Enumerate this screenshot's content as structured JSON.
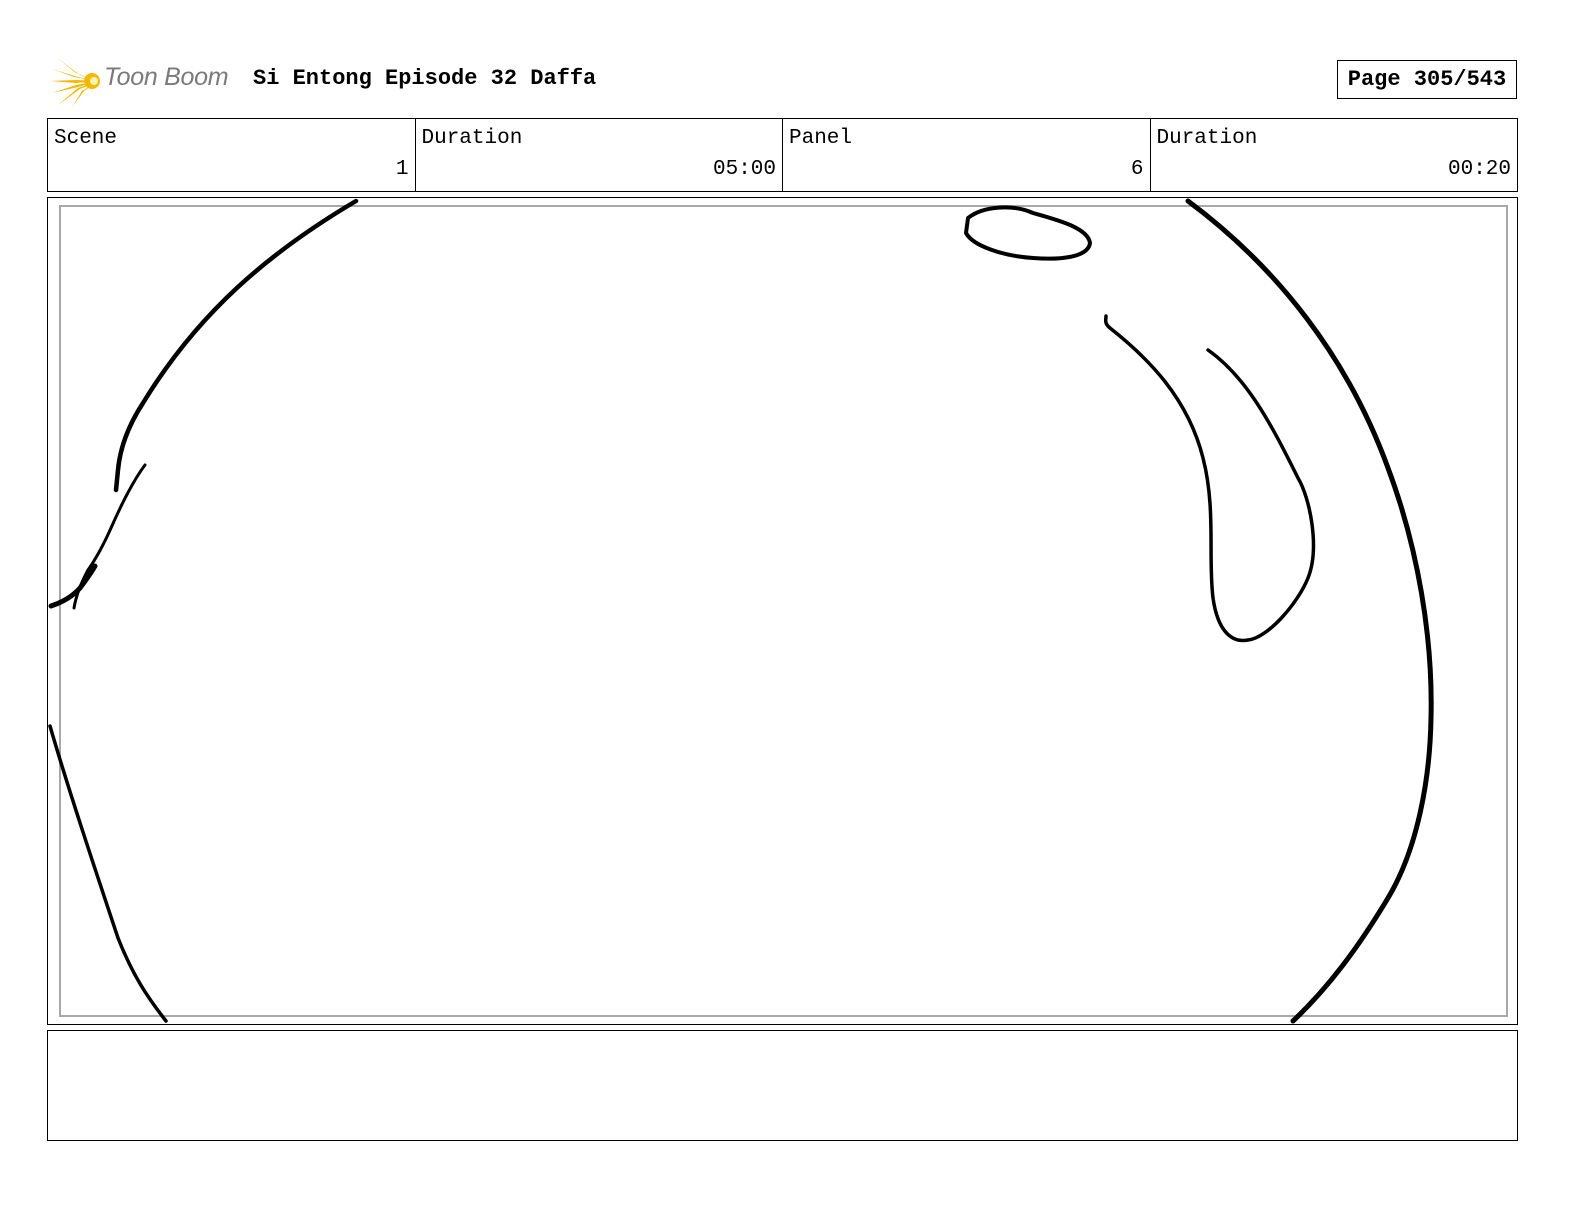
{
  "header": {
    "logo_text": "Toon Boom",
    "title": "Si Entong Episode 32 Daffa",
    "page_indicator": "Page 305/543"
  },
  "info": {
    "scene_label": "Scene",
    "scene_value": "1",
    "scene_duration_label": "Duration",
    "scene_duration_value": "05:00",
    "panel_label": "Panel",
    "panel_value": "6",
    "panel_duration_label": "Duration",
    "panel_duration_value": "00:20"
  },
  "notes": {
    "text": ""
  },
  "colors": {
    "logo_star": "#f5b800",
    "logo_text": "#7a7a7a",
    "panel_frame": "#a8a8a8",
    "sketch_line": "#000000"
  }
}
